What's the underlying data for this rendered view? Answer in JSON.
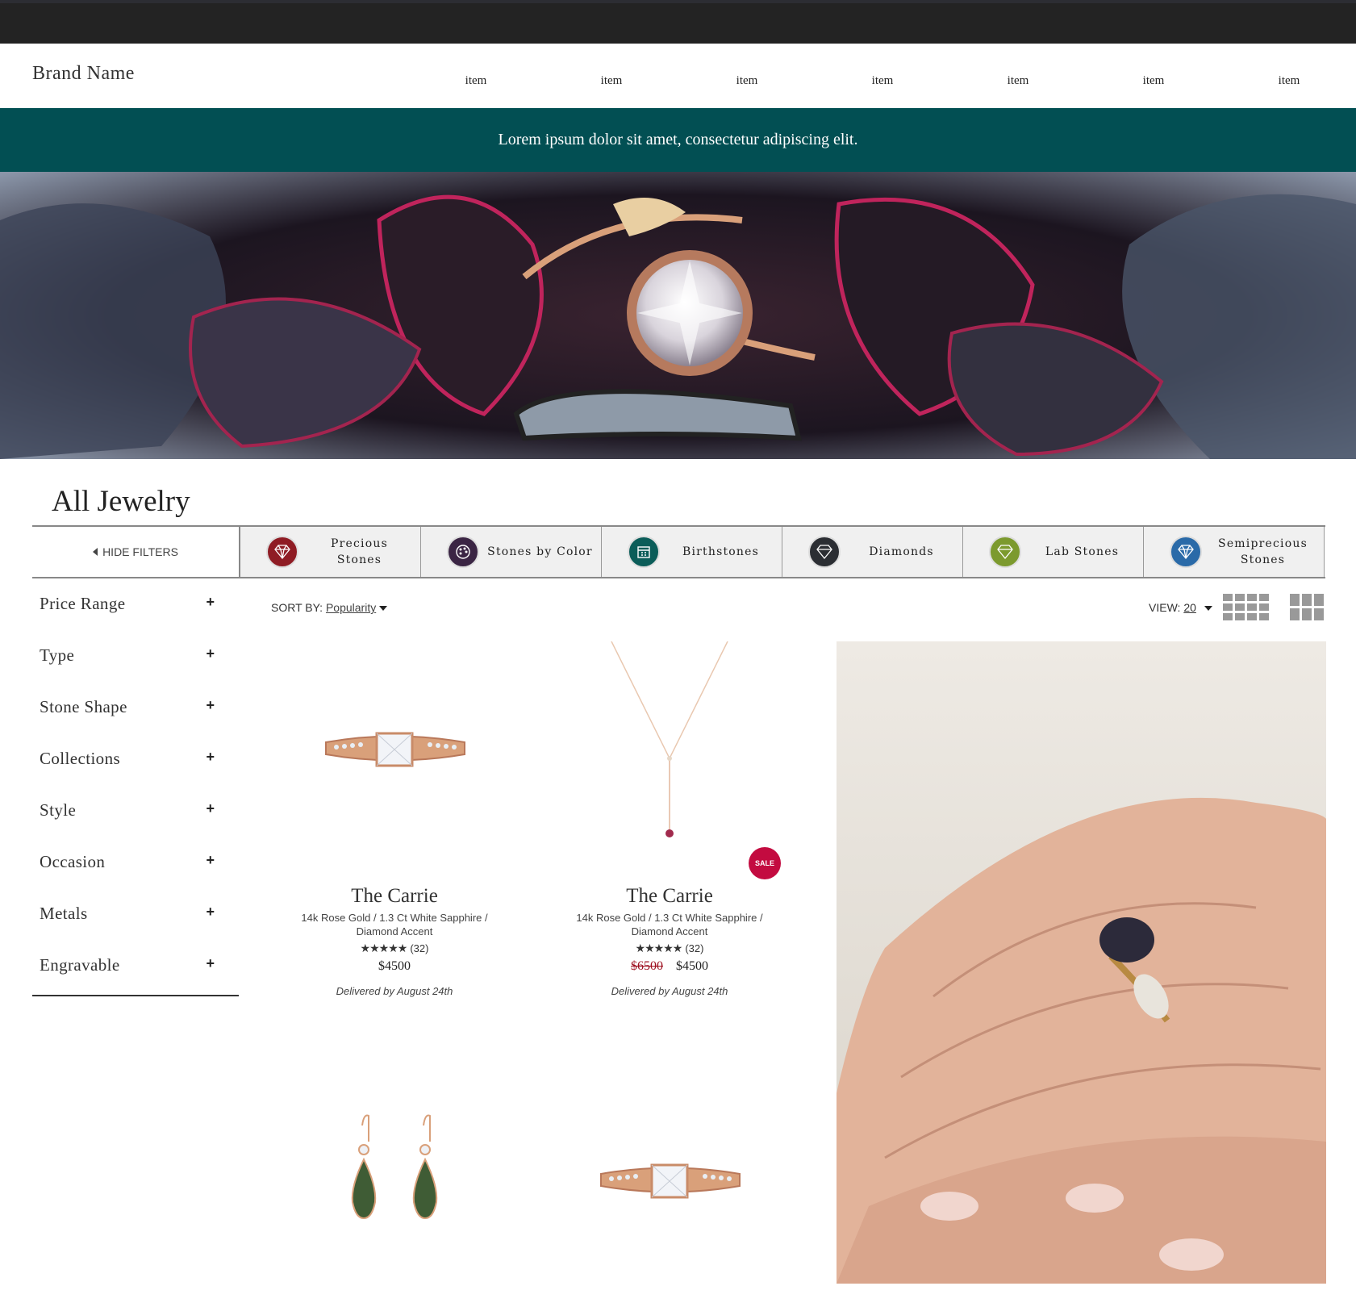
{
  "header": {
    "brand": "Brand Name",
    "nav": [
      "item",
      "item",
      "item",
      "item",
      "item",
      "item",
      "item"
    ]
  },
  "promo": {
    "text": "Lorem ipsum dolor sit amet, consectetur adipiscing elit."
  },
  "page": {
    "title": "All Jewelry"
  },
  "categories": {
    "hide_filters": "HIDE FILTERS",
    "items": [
      {
        "label": "Precious Stones",
        "icon": "gem-icon",
        "color": "#8f1c24"
      },
      {
        "label": "Stones by Color",
        "icon": "palette-icon",
        "color": "#3b2544"
      },
      {
        "label": "Birthstones",
        "icon": "calendar-icon",
        "color": "#0b5d59"
      },
      {
        "label": "Diamonds",
        "icon": "diamond-icon",
        "color": "#2b2e33"
      },
      {
        "label": "Lab Stones",
        "icon": "lab-gem-icon",
        "color": "#7c9a2e"
      },
      {
        "label": "Semiprecious Stones",
        "icon": "gem-icon",
        "color": "#2a6aa8"
      }
    ]
  },
  "filters": [
    "Price Range",
    "Type",
    "Stone Shape",
    "Collections",
    "Style",
    "Occasion",
    "Metals",
    "Engravable"
  ],
  "toolbar": {
    "sort_label": "SORT BY:",
    "sort_value": "Popularity",
    "view_label": "VIEW:",
    "view_value": "20"
  },
  "products": [
    {
      "name": "The Carrie",
      "desc1": "14k Rose Gold / 1.3 Ct White Sapphire /",
      "desc2": "Diamond Accent",
      "rating": 4.5,
      "reviews": "(32)",
      "price": "$4500",
      "delivery": "Delivered by August 24th"
    },
    {
      "name": "The Carrie",
      "desc1": "14k Rose Gold / 1.3 Ct White Sapphire /",
      "desc2": "Diamond Accent",
      "rating": 4.5,
      "reviews": "(32)",
      "old_price": "$6500",
      "price": "$4500",
      "badge": "SALE",
      "delivery": "Delivered by August 24th"
    }
  ],
  "colors": {
    "accent": "#024f53",
    "sale": "#c30b40",
    "topbar": "#232323"
  }
}
